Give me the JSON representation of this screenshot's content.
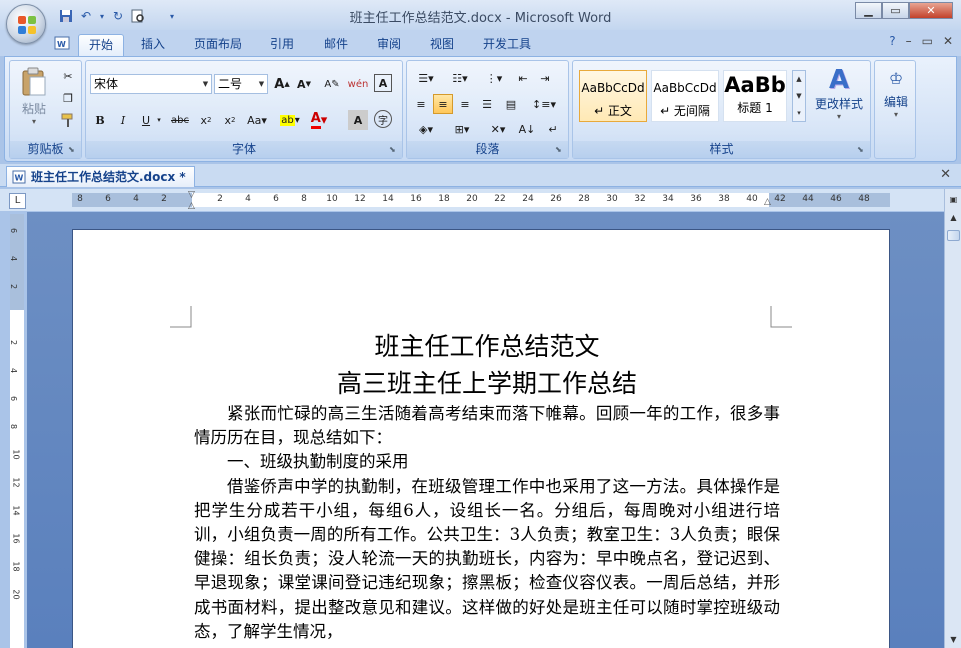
{
  "window": {
    "title": "班主任工作总结范文.docx - Microsoft Word"
  },
  "ribbon_tabs": [
    {
      "label": "开始",
      "active": true
    },
    {
      "label": "插入"
    },
    {
      "label": "页面布局"
    },
    {
      "label": "引用"
    },
    {
      "label": "邮件"
    },
    {
      "label": "审阅"
    },
    {
      "label": "视图"
    },
    {
      "label": "开发工具"
    }
  ],
  "groups": {
    "clipboard": {
      "label": "剪贴板",
      "paste_label": "粘贴"
    },
    "font": {
      "label": "字体",
      "font_name": "宋体",
      "font_size": "二号"
    },
    "paragraph": {
      "label": "段落"
    },
    "styles": {
      "label": "样式",
      "items": [
        {
          "sample": "AaBbCcDd",
          "name": "↵ 正文"
        },
        {
          "sample": "AaBbCcDd",
          "name": "↵ 无间隔"
        },
        {
          "sample": "AaBb",
          "name": "标题 1"
        }
      ],
      "change_styles_label": "更改样式"
    },
    "editing": {
      "label": "编辑"
    }
  },
  "document_tab": {
    "label": "班主任工作总结范文.docx *"
  },
  "ruler_numbers": [
    "8",
    "6",
    "4",
    "2",
    "",
    "2",
    "4",
    "6",
    "8",
    "10",
    "12",
    "14",
    "16",
    "18",
    "20",
    "22",
    "24",
    "26",
    "28",
    "30",
    "32",
    "34",
    "36",
    "38",
    "40",
    "42",
    "44",
    "46",
    "48"
  ],
  "vruler_numbers": [
    "6",
    "4",
    "2",
    "",
    "2",
    "4",
    "6",
    "8",
    "10",
    "12",
    "14",
    "16",
    "18",
    "20"
  ],
  "document": {
    "title": "班主任工作总结范文",
    "subtitle": "高三班主任上学期工作总结",
    "paragraphs": [
      "紧张而忙碌的高三生活随着高考结束而落下帷幕。回顾一年的工作，很多事情历历在目，现总结如下：",
      "一、班级执勤制度的采用",
      "借鉴侨声中学的执勤制，在班级管理工作中也采用了这一方法。具体操作是把学生分成若干小组，每组6人，设组长一名。分组后，每周晚对小组进行培训，小组负责一周的所有工作。公共卫生：3人负责；教室卫生：3人负责；眼保健操：组长负责；没人轮流一天的执勤班长，内容为：早中晚点名，登记迟到、早退现象；课堂课间登记违纪现象；擦黑板；检查仪容仪表。一周后总结，并形成书面材料，提出整改意见和建议。这样做的好处是班主任可以随时掌控班级动态，了解学生情况，"
    ]
  }
}
